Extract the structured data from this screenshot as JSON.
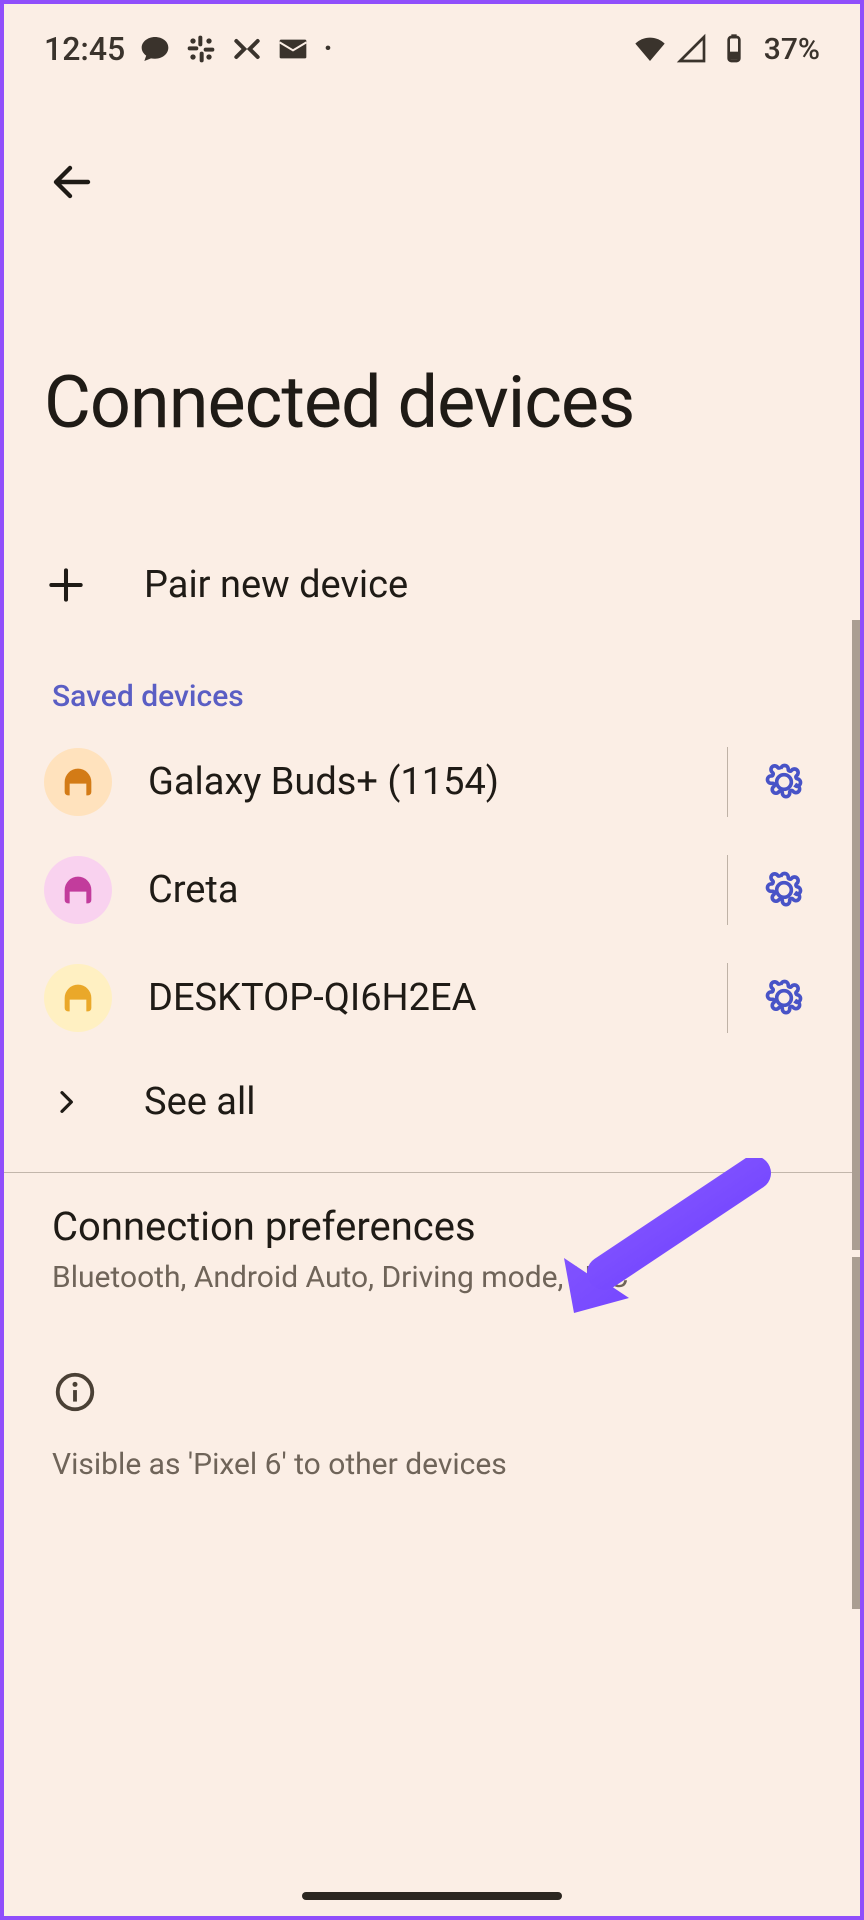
{
  "statusBar": {
    "time": "12:45",
    "batteryText": "37%"
  },
  "pageTitle": "Connected devices",
  "pairNew": {
    "label": "Pair new device"
  },
  "savedHeader": "Saved devices",
  "devices": [
    {
      "name": "Galaxy Buds+ (1154)",
      "avatarClass": "orange"
    },
    {
      "name": "Creta",
      "avatarClass": "pink"
    },
    {
      "name": "DESKTOP-QI6H2EA",
      "avatarClass": "yellow"
    }
  ],
  "seeAll": {
    "label": "See all"
  },
  "connectionPreferences": {
    "title": "Connection preferences",
    "subtitle": "Bluetooth, Android Auto, Driving mode, NFC"
  },
  "visibleAs": "Visible as 'Pixel 6' to other devices"
}
